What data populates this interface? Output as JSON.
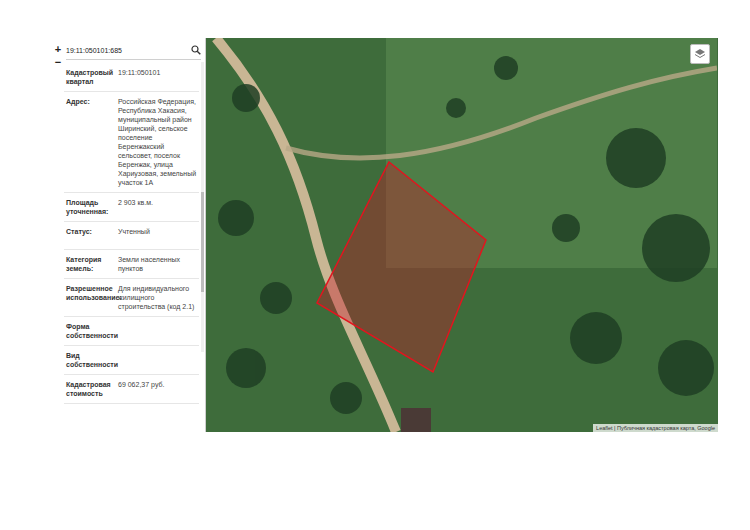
{
  "map_controls": {
    "zoom_in": "+",
    "zoom_out": "−"
  },
  "search": {
    "value": "19:11:050101:685"
  },
  "fields": [
    {
      "label": "Кадастровый квартал",
      "value": "19:11:050101"
    },
    {
      "label": "Адрес:",
      "value": "Российская Федерация, Республика Хакасия, муниципальный район Ширинский, сельское поселение Беренжакский сельсовет, поселок Беренжак, улица Хариузовая, земельный участок 1А"
    },
    {
      "label": "Площадь уточненная:",
      "value": "2 903 кв.м."
    },
    {
      "label": "Статус:",
      "value": "Учтенный"
    },
    {
      "label": "Категория земель:",
      "value": "Земли населенных пунктов"
    },
    {
      "label": "Разрешенное использование:",
      "value": "Для индивидуального жилищного строительства (код 2.1)"
    },
    {
      "label": "Форма собственности",
      "value": ""
    },
    {
      "label": "Вид собственности",
      "value": ""
    },
    {
      "label": "Кадастровая стоимость",
      "value": "69 062,37 руб."
    }
  ],
  "attribution": "Leaflet | Публичная кадастровая карта, Google"
}
